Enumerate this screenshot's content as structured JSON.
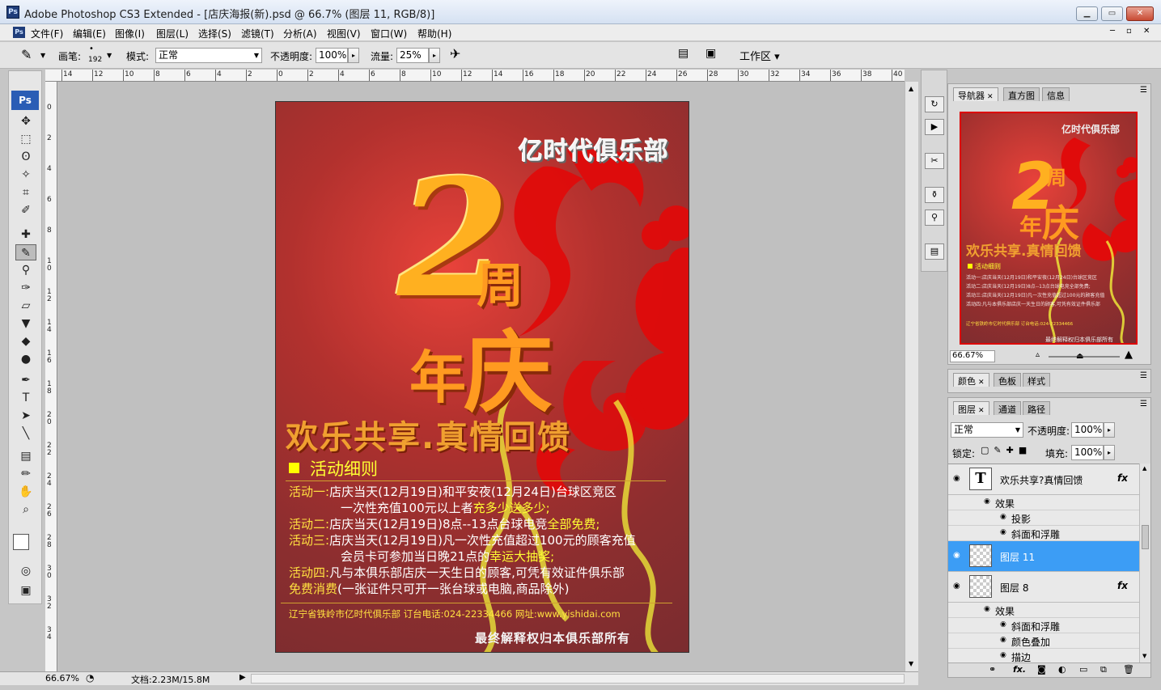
{
  "window": {
    "title": "Adobe Photoshop CS3 Extended - [店庆海报(新).psd @ 66.7% (图层 11, RGB/8)]",
    "app_icon": "Ps"
  },
  "menu": [
    "文件(F)",
    "编辑(E)",
    "图像(I)",
    "图层(L)",
    "选择(S)",
    "滤镜(T)",
    "分析(A)",
    "视图(V)",
    "窗口(W)",
    "帮助(H)"
  ],
  "options": {
    "brush_label": "画笔:",
    "brush_size": "192",
    "mode_label": "模式:",
    "mode_value": "正常",
    "opacity_label": "不透明度:",
    "opacity_value": "100%",
    "flow_label": "流量:",
    "flow_value": "25%",
    "workspace_label": "工作区"
  },
  "ruler_h": [
    "14",
    "12",
    "10",
    "8",
    "6",
    "4",
    "2",
    "0",
    "2",
    "4",
    "6",
    "8",
    "10",
    "12",
    "14",
    "16",
    "18",
    "20",
    "22",
    "24",
    "26",
    "28",
    "30",
    "32",
    "34",
    "36",
    "38",
    "40"
  ],
  "ruler_v": [
    "0",
    "2",
    "4",
    "6",
    "8",
    "1 0",
    "1 2",
    "1 4",
    "1 6",
    "1 8",
    "2 0",
    "2 2",
    "2 4",
    "2 6",
    "2 8",
    "3 0",
    "3 2",
    "3 4"
  ],
  "poster": {
    "club": "亿时代俱乐部",
    "big2": "2",
    "zhou": "周",
    "nian": "年",
    "qing": "庆",
    "slogan": "欢乐共享.真情回馈",
    "section": "活动细则",
    "a1_label": "活动一:",
    "a1_text": "店庆当天(12月19日)和平安夜(12月24日)台球区竞区",
    "a1_line2a": "一次性充值100元以上者",
    "a1_line2b": "充多少送多少;",
    "a2_label": "活动二:",
    "a2_text": "店庆当天(12月19日)8点--13点台球电竞",
    "a2_hl": "全部免费;",
    "a3_label": "活动三:",
    "a3_text": "店庆当天(12月19日)凡一次性充值超过100元的顾客充值",
    "a3_line2a": "会员卡可参加当日晚21点的",
    "a3_line2b": "幸运大抽奖;",
    "a4_label": "活动四:",
    "a4_text": "凡与本俱乐部店庆一天生日的顾客,可凭有效证件俱乐部",
    "a4_line2a": "免费消费",
    "a4_line2b": "(一张证件只可开一张台球或电脑,商品除外)",
    "contact": "辽宁省铁岭市亿时代俱乐部 订台电话:024-22334466 网址:www.yishidai.com",
    "footer": "最终解释权归本俱乐部所有"
  },
  "status": {
    "zoom": "66.67%",
    "doc": "文档:2.23M/15.8M"
  },
  "navigator": {
    "tabs": [
      "导航器",
      "直方图",
      "信息"
    ],
    "zoom": "66.67%"
  },
  "color_panel": {
    "tabs": [
      "颜色",
      "色板",
      "样式"
    ]
  },
  "layers_panel": {
    "tabs": [
      "图层",
      "通道",
      "路径"
    ],
    "blend": "正常",
    "opacity_label": "不透明度:",
    "opacity": "100%",
    "lock_label": "锁定:",
    "fill_label": "填充:",
    "fill": "100%",
    "rows": [
      {
        "type": "layer",
        "name": "欢乐共享?真情回馈",
        "thumb": "T",
        "fx": "fx",
        "sel": false
      },
      {
        "type": "sub",
        "name": "效果",
        "indent": 1
      },
      {
        "type": "sub",
        "name": "投影",
        "indent": 2
      },
      {
        "type": "sub",
        "name": "斜面和浮雕",
        "indent": 2
      },
      {
        "type": "layer",
        "name": "图层 11",
        "thumb": "",
        "fx": "",
        "sel": true
      },
      {
        "type": "layer",
        "name": "图层 8",
        "thumb": "",
        "fx": "fx",
        "sel": false
      },
      {
        "type": "sub",
        "name": "效果",
        "indent": 1
      },
      {
        "type": "sub",
        "name": "斜面和浮雕",
        "indent": 2
      },
      {
        "type": "sub",
        "name": "颜色叠加",
        "indent": 2
      },
      {
        "type": "sub",
        "name": "描边",
        "indent": 2
      }
    ]
  },
  "colors": {
    "selection": "#3c9df5",
    "highlight_yellow": "#ffff00",
    "poster_text_yellow": "#f5e04a"
  }
}
